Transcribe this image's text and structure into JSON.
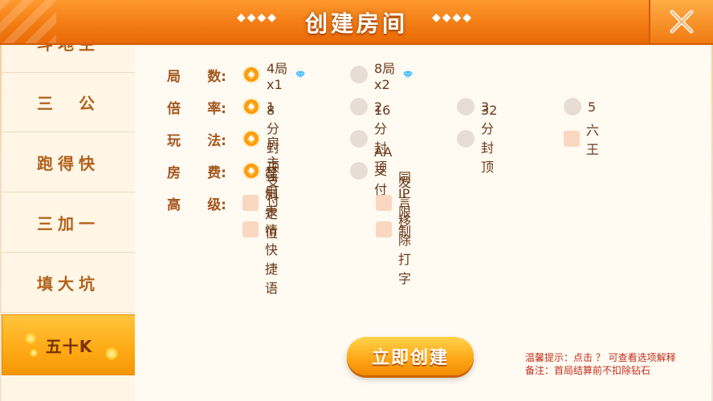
{
  "header": {
    "title": "创建房间",
    "deco": "◆◆◆◆"
  },
  "sidebar": {
    "items": [
      {
        "label": "斗地主"
      },
      {
        "label": "三　公"
      },
      {
        "label": "跑得快"
      },
      {
        "label": "三加一"
      },
      {
        "label": "填大坑"
      },
      {
        "label": "五十K",
        "active": true
      }
    ]
  },
  "options": {
    "rounds": {
      "label": [
        "局",
        "数:"
      ],
      "choices": [
        "4局x1",
        "8局x2"
      ],
      "selected": 0
    },
    "multiplier": {
      "label": [
        "倍",
        "率:"
      ],
      "choices": [
        "1",
        "2",
        "3",
        "5"
      ],
      "selected": 0
    },
    "play": {
      "label": [
        "玩",
        "法:"
      ],
      "choices": [
        "8分封顶",
        "16分封顶",
        "32分封顶"
      ],
      "selected": 0,
      "extra_check": "六王"
    },
    "fee": {
      "label": [
        "房",
        "费:"
      ],
      "choices": [
        "房主支付",
        "AA支付"
      ],
      "selected": 0
    },
    "advanced": {
      "label": [
        "高",
        "级:"
      ],
      "checks": [
        "强制定位",
        "同IP限制",
        "禁用表情快捷语",
        "发言移除打字"
      ]
    }
  },
  "create_button": {
    "label": "立即创建"
  },
  "tips": {
    "line1": "温馨提示：点击 ？ 可查看选项解释",
    "line2": "备注：首局结算前不扣除钻石"
  },
  "colors": {
    "accent": "#f27a12",
    "label": "#a3561c",
    "active_tab": "#ffb01c",
    "tip": "#c0301c"
  }
}
